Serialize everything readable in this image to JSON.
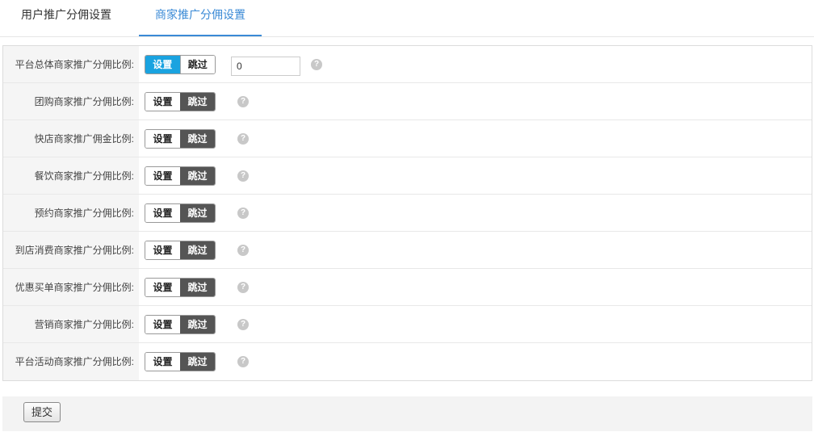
{
  "tabs": [
    {
      "label": "用户推广分佣设置",
      "active": false
    },
    {
      "label": "商家推广分佣设置",
      "active": true
    }
  ],
  "form": {
    "set_label": "设置",
    "skip_label": "跳过",
    "help_glyph": "?",
    "rows": [
      {
        "label": "平台总体商家推广分佣比例:",
        "selected": "设置",
        "value": "0"
      },
      {
        "label": "团购商家推广分佣比例:",
        "selected": "跳过"
      },
      {
        "label": "快店商家推广佣金比例:",
        "selected": "跳过"
      },
      {
        "label": "餐饮商家推广分佣比例:",
        "selected": "跳过"
      },
      {
        "label": "预约商家推广分佣比例:",
        "selected": "跳过"
      },
      {
        "label": "到店消费商家推广分佣比例:",
        "selected": "跳过"
      },
      {
        "label": "优惠买单商家推广分佣比例:",
        "selected": "跳过"
      },
      {
        "label": "营销商家推广分佣比例:",
        "selected": "跳过"
      },
      {
        "label": "平台活动商家推广分佣比例:",
        "selected": "跳过"
      }
    ]
  },
  "footer": {
    "submit_label": "提交"
  },
  "colors": {
    "accent": "#3a8ad6",
    "toggle_on": "#1aa3e0",
    "toggle_dark": "#555555"
  }
}
